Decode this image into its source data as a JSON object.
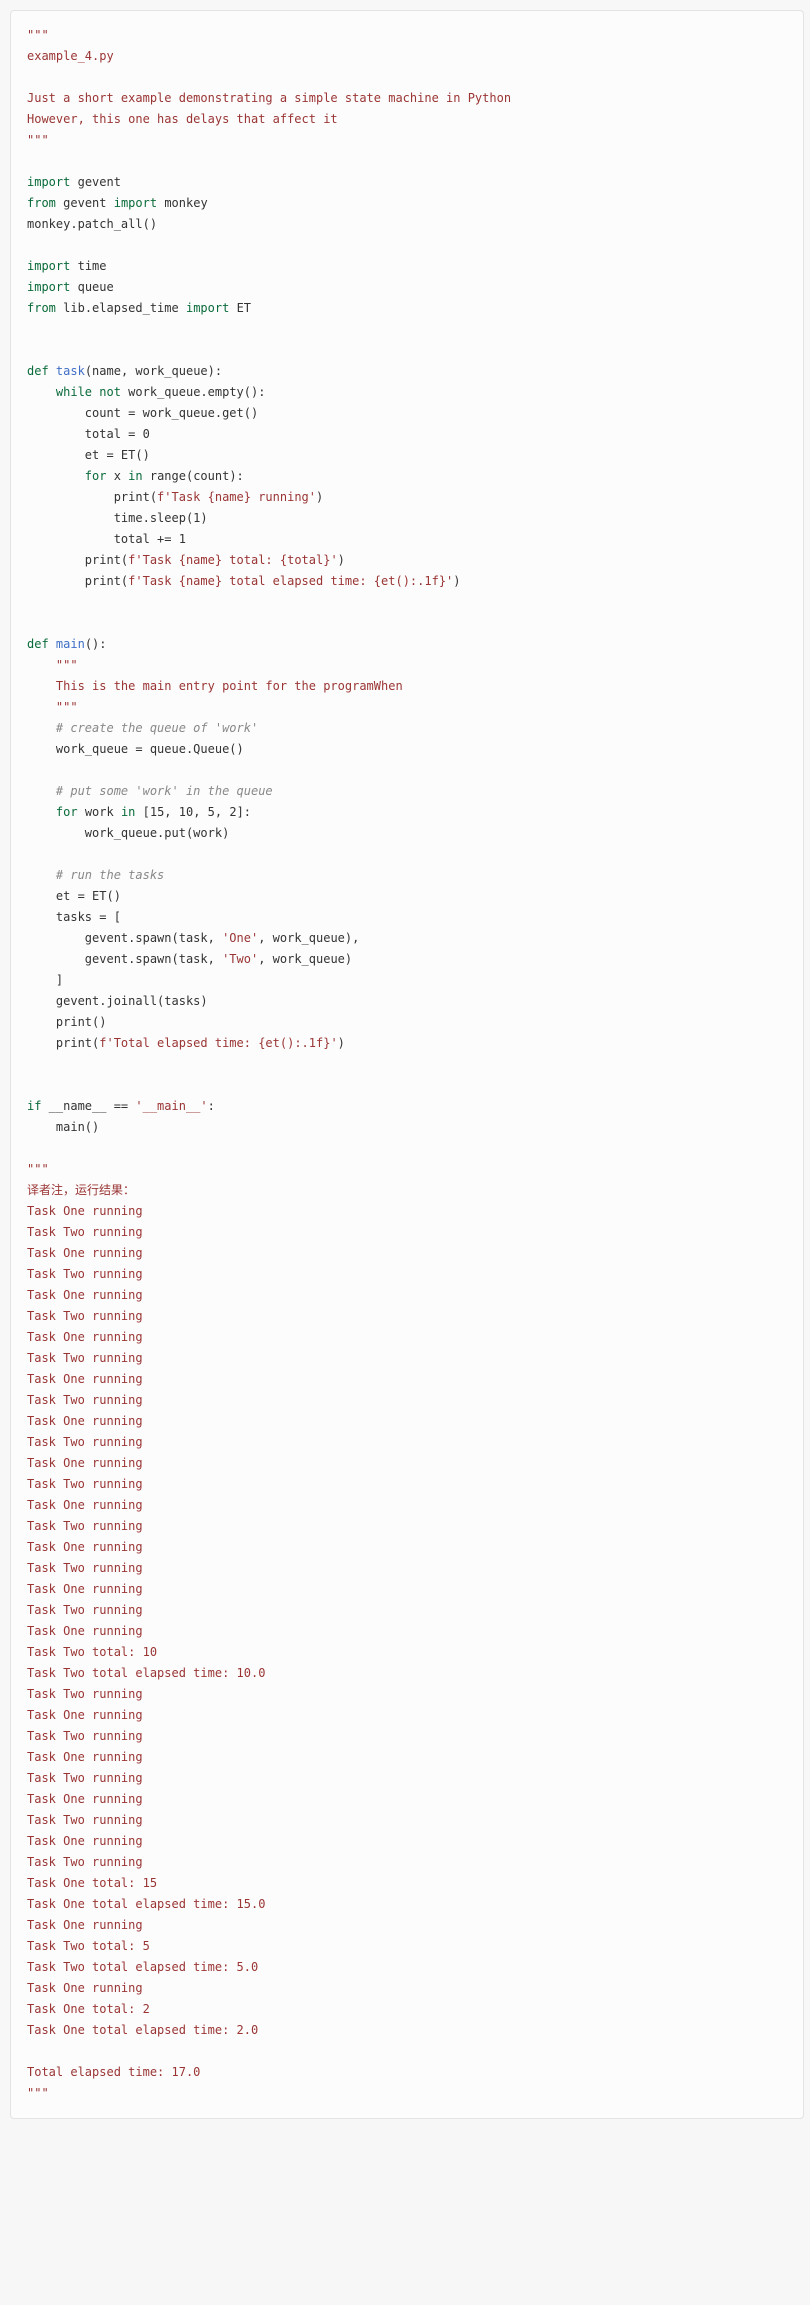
{
  "code": {
    "doc1": "\"\"\"",
    "doc2": "example_4.py",
    "doc3": "",
    "doc4": "Just a short example demonstrating a simple state machine in Python",
    "doc5": "However, this one has delays that affect it",
    "doc6": "\"\"\"",
    "imp1_kw": "import",
    "imp1_mod": "gevent",
    "imp2_kw1": "from",
    "imp2_mod": "gevent",
    "imp2_kw2": "import",
    "imp2_name": "monkey",
    "monkey": "monkey.patch_all()",
    "imp3_kw": "import",
    "imp3_mod": "time",
    "imp4_kw": "import",
    "imp4_mod": "queue",
    "imp5_kw1": "from",
    "imp5_mod": "lib.elapsed_time",
    "imp5_kw2": "import",
    "imp5_name": "ET",
    "def1_kw": "def",
    "def1_name": "task",
    "def1_args": "(name, work_queue):",
    "t_while_kw": "while",
    "t_while_not": "not",
    "t_while_rest": " work_queue.empty():",
    "t_count": "        count = work_queue.get()",
    "t_total": "        total = ",
    "t_total_num": "0",
    "t_et": "        et = ET()",
    "t_for_kw": "for",
    "t_for_x": " x ",
    "t_for_in": "in",
    "t_for_range": " range(count):",
    "t_print1_pre": "            print(",
    "t_print1_str": "f'Task {name} running'",
    "t_print1_post": ")",
    "t_sleep_pre": "            time.sleep(",
    "t_sleep_num": "1",
    "t_sleep_post": ")",
    "t_inc": "            total += ",
    "t_inc_num": "1",
    "t_print2_pre": "        print(",
    "t_print2_str": "f'Task {name} total: {total}'",
    "t_print2_post": ")",
    "t_print3_pre": "        print(",
    "t_print3_str": "f'Task {name} total elapsed time: {et():.1f}'",
    "t_print3_post": ")",
    "def2_kw": "def",
    "def2_name": "main",
    "def2_args": "():",
    "m_doc1": "    \"\"\"",
    "m_doc2": "    This is the main entry point for the programWhen",
    "m_doc3": "    \"\"\"",
    "m_c1": "    # create the queue of 'work'",
    "m_wq": "    work_queue = queue.Queue()",
    "m_c2": "    # put some 'work' in the queue",
    "m_for_pre": "    ",
    "m_for_kw": "for",
    "m_for_mid": " work ",
    "m_for_in": "in",
    "m_for_list": " [",
    "m_for_nums": "15, 10, 5, 2",
    "m_for_end": "]:",
    "m_put": "        work_queue.put(work)",
    "m_c3": "    # run the tasks",
    "m_et": "    et = ET()",
    "m_tasks": "    tasks = [",
    "m_sp1_pre": "        gevent.spawn(task, ",
    "m_sp1_str": "'One'",
    "m_sp1_post": ", work_queue),",
    "m_sp2_pre": "        gevent.spawn(task, ",
    "m_sp2_str": "'Two'",
    "m_sp2_post": ", work_queue)",
    "m_tasks_end": "    ]",
    "m_join": "    gevent.joinall(tasks)",
    "m_print": "    print()",
    "m_print2_pre": "    print(",
    "m_print2_str": "f'Total elapsed time: {et():.1f}'",
    "m_print2_post": ")",
    "if_kw": "if",
    "if_name": " __name__ == ",
    "if_str": "'__main__'",
    "if_colon": ":",
    "if_main": "    main()",
    "out_doc1": "\"\"\"",
    "out_title": "译者注，运行结果：",
    "output_lines": [
      "Task One running",
      "Task Two running",
      "Task One running",
      "Task Two running",
      "Task One running",
      "Task Two running",
      "Task One running",
      "Task Two running",
      "Task One running",
      "Task Two running",
      "Task One running",
      "Task Two running",
      "Task One running",
      "Task Two running",
      "Task One running",
      "Task Two running",
      "Task One running",
      "Task Two running",
      "Task One running",
      "Task Two running",
      "Task One running",
      "Task Two total: 10",
      "Task Two total elapsed time: 10.0",
      "Task Two running",
      "Task One running",
      "Task Two running",
      "Task One running",
      "Task Two running",
      "Task One running",
      "Task Two running",
      "Task One running",
      "Task Two running",
      "Task One total: 15",
      "Task One total elapsed time: 15.0",
      "Task One running",
      "Task Two total: 5",
      "Task Two total elapsed time: 5.0",
      "Task One running",
      "Task One total: 2",
      "Task One total elapsed time: 2.0",
      "",
      "Total elapsed time: 17.0"
    ],
    "out_doc2": "\"\"\""
  }
}
